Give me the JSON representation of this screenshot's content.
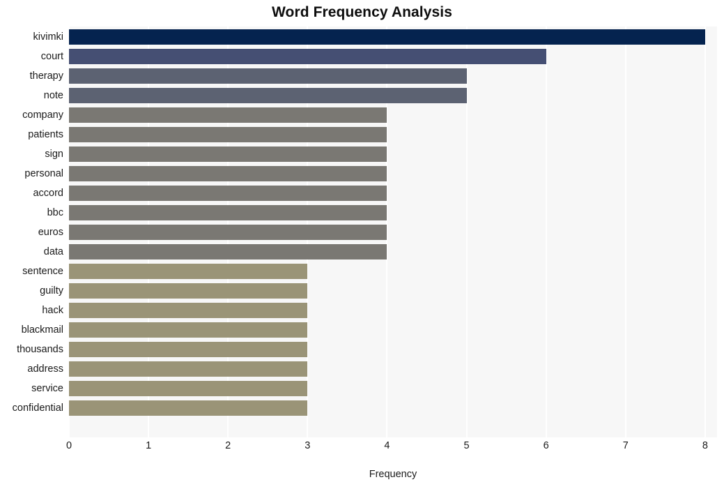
{
  "chart_data": {
    "type": "bar",
    "orientation": "horizontal",
    "title": "Word Frequency Analysis",
    "xlabel": "Frequency",
    "ylabel": "",
    "xlim": [
      0,
      8.15
    ],
    "xticks": [
      0,
      1,
      2,
      3,
      4,
      5,
      6,
      7,
      8
    ],
    "xticklabels": [
      "0",
      "1",
      "2",
      "3",
      "4",
      "5",
      "6",
      "7",
      "8"
    ],
    "grid": "vertical-white-on-lightgray",
    "legend": "none",
    "categories": [
      "kivimki",
      "court",
      "therapy",
      "note",
      "company",
      "patients",
      "sign",
      "personal",
      "accord",
      "bbc",
      "euros",
      "data",
      "sentence",
      "guilty",
      "hack",
      "blackmail",
      "thousands",
      "address",
      "service",
      "confidential"
    ],
    "values": [
      8,
      6,
      5,
      5,
      4,
      4,
      4,
      4,
      4,
      4,
      4,
      4,
      3,
      3,
      3,
      3,
      3,
      3,
      3,
      3
    ],
    "bar_colors": [
      "#05234f",
      "#454f73",
      "#5c6272",
      "#5c6272",
      "#7a7873",
      "#7a7873",
      "#7a7873",
      "#7a7873",
      "#7a7873",
      "#7a7873",
      "#7a7873",
      "#7a7873",
      "#9a9477",
      "#9a9477",
      "#9a9477",
      "#9a9477",
      "#9a9477",
      "#9a9477",
      "#9a9477",
      "#9a9477"
    ]
  },
  "style": {
    "plot_background": "#f7f7f7",
    "grid_color": "#ffffff",
    "page_background": "#ffffff",
    "text_color": "#1a1a1a",
    "title_color": "#0d0d0d"
  }
}
